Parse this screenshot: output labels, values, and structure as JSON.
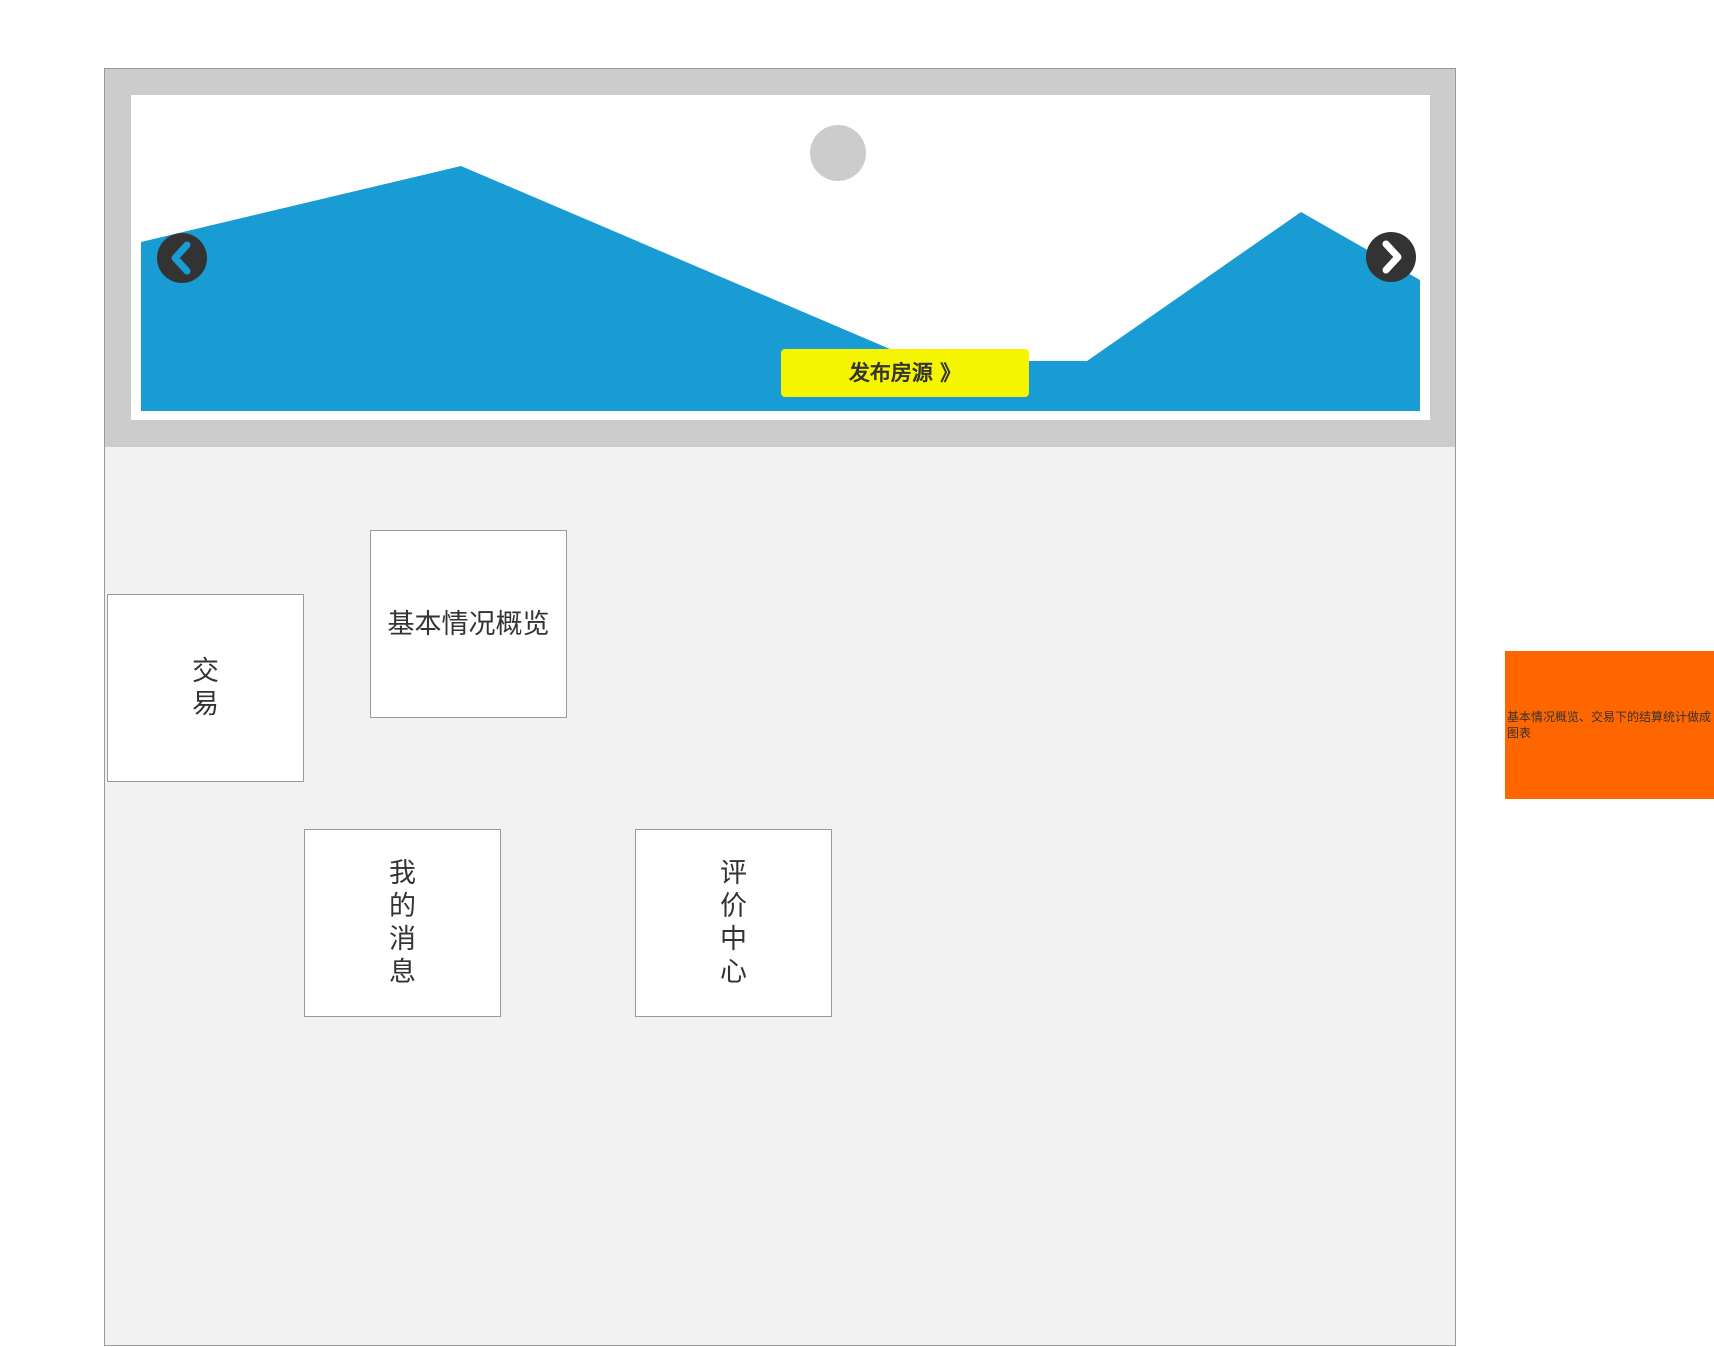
{
  "carousel": {
    "prev_icon": "chevron-left-circle-icon",
    "next_icon": "chevron-right-circle-icon",
    "placeholder_icon": "image-placeholder-icon",
    "publish_button_label": "发布房源 》",
    "colors": {
      "frame": "#cccccc",
      "mountain": "#199bd4",
      "sun": "#cccccc",
      "button": "#f5f500",
      "arrow": "#333333"
    }
  },
  "tiles": {
    "trade": "交易",
    "overview": "基本情况概览",
    "messages": "我的消息",
    "reviews": "评价中心"
  },
  "note": {
    "text": "基本情况概览、交易下的结算统计做成图表",
    "color": "#ff6600"
  }
}
